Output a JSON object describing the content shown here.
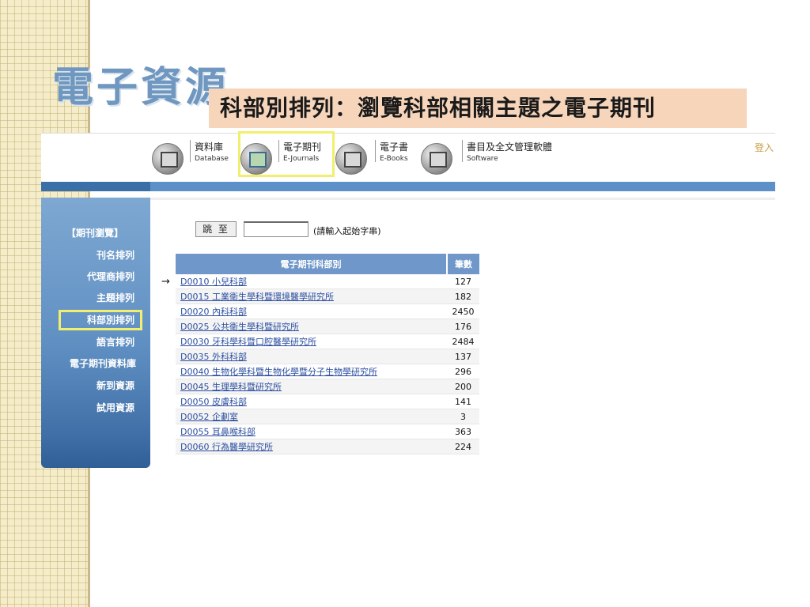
{
  "slide": {
    "title": "電子資源",
    "callout": "科部別排列：瀏覽科部相關主題之電子期刊"
  },
  "nav": {
    "items": [
      {
        "label": "資料庫",
        "sub": "Database",
        "icon": "database-icon"
      },
      {
        "label": "電子期刊",
        "sub": "E-Journals",
        "icon": "e-journals-icon"
      },
      {
        "label": "電子書",
        "sub": "E-Books",
        "icon": "e-books-icon"
      },
      {
        "label": "書目及全文管理軟體",
        "sub": "Software",
        "icon": "software-icon"
      }
    ],
    "login": "登入"
  },
  "sidebar": {
    "heading": "【期刊瀏覽】",
    "items": [
      {
        "label": "刊名排列"
      },
      {
        "label": "代理商排列"
      },
      {
        "label": "主題排列"
      },
      {
        "label": "科部別排列"
      },
      {
        "label": "語言排列"
      },
      {
        "label": "電子期刊資料庫"
      },
      {
        "label": "新到資源"
      },
      {
        "label": "試用資源"
      }
    ],
    "active": "科部別排列"
  },
  "jump": {
    "button": "跳 至",
    "input_value": "",
    "hint": "(請輸入起始字串)"
  },
  "table": {
    "headers": {
      "name": "電子期刊科部別",
      "count": "筆數"
    },
    "rows": [
      {
        "name": "D0010 小兒科部",
        "count": "127"
      },
      {
        "name": "D0015 工業衛生學科暨環境醫學研究所",
        "count": "182"
      },
      {
        "name": "D0020 內科科部",
        "count": "2450"
      },
      {
        "name": "D0025 公共衛生學科暨研究所",
        "count": "176"
      },
      {
        "name": "D0030 牙科學科暨口腔醫學研究所",
        "count": "2484"
      },
      {
        "name": "D0035 外科科部",
        "count": "137"
      },
      {
        "name": "D0040 生物化學科暨生物化學暨分子生物學研究所",
        "count": "296"
      },
      {
        "name": "D0045 生理學科暨研究所",
        "count": "200"
      },
      {
        "name": "D0050 皮膚科部",
        "count": "141"
      },
      {
        "name": "D0052 企劃室",
        "count": "3"
      },
      {
        "name": "D0055 耳鼻喉科部",
        "count": "363"
      },
      {
        "name": "D0060 行為醫學研究所",
        "count": "224"
      }
    ],
    "pointer": "→"
  },
  "colors": {
    "accent_blue": "#5d8fc9",
    "highlight_yellow": "#f3ef6e",
    "callout_bg": "#f7d5bb",
    "title_blue": "#6f97bf"
  }
}
